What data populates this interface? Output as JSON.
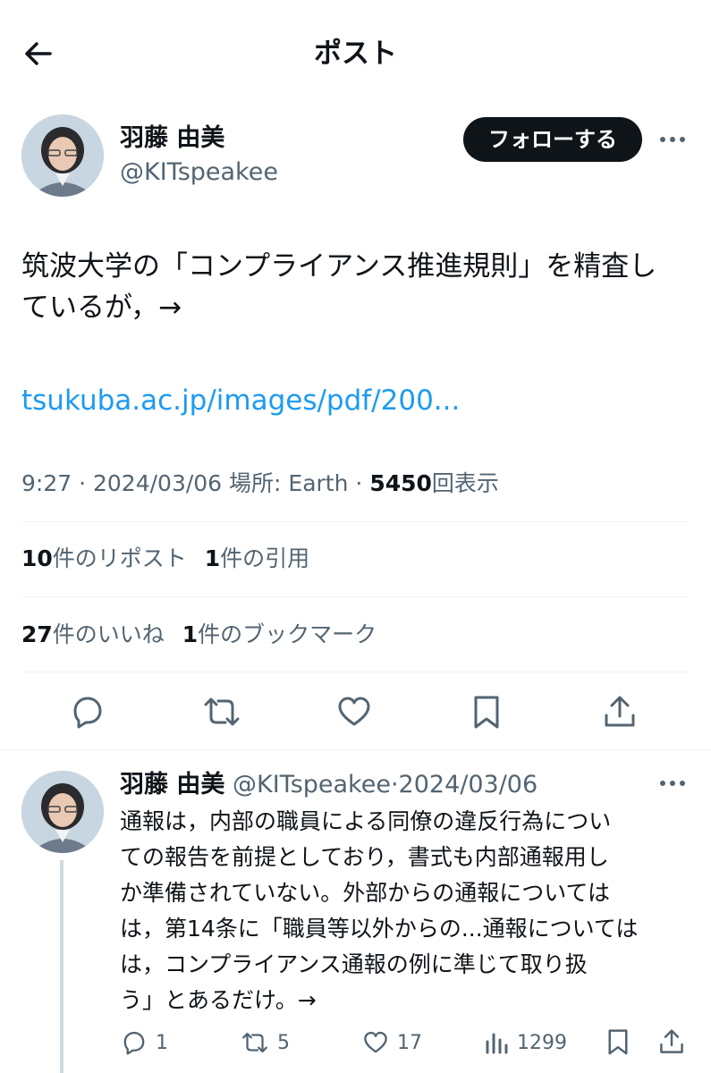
{
  "header": {
    "title": "ポスト",
    "back_icon": "arrow-left-icon"
  },
  "author": {
    "name": "羽藤 由美",
    "handle": "@KITspeakee",
    "follow_label": "フォローする",
    "more_icon": "more-horizontal-icon"
  },
  "post": {
    "text_line1": "筑波大学の「コンプライアンス推進規則」を精査し",
    "text_line2": "ているが，→",
    "link": "tsukuba.ac.jp/images/pdf/200..."
  },
  "meta": {
    "time": "9:27",
    "dot1": "·",
    "date": "2024/03/06",
    "place": "場所: Earth",
    "dot2": "·",
    "views": "5450",
    "views_label": "回表示"
  },
  "stats": {
    "reposts_count": "10",
    "reposts_label": "件のリポスト",
    "quotes_count": "1",
    "quotes_label": "件の引用",
    "likes_count": "27",
    "likes_label": "件のいいね",
    "bookmarks_count": "1",
    "bookmarks_label": "件のブックマーク"
  },
  "actions": {
    "reply_icon": "reply-icon",
    "repost_icon": "repost-icon",
    "like_icon": "heart-icon",
    "bookmark_icon": "bookmark-icon",
    "share_icon": "share-icon"
  },
  "reply": {
    "name": "羽藤 由美",
    "handle": "@KITspeakee",
    "sep": "·",
    "date": "2024/03/06",
    "lines": [
      "通報は，内部の職員による同僚の違反行為につい",
      "ての報告を前提としており，書式も内部通報用し",
      "か準備されていない。外部からの通報については",
      "は，第14条に「職員等以外からの...通報については",
      "は，コンプライアンス通報の例に準じて取り扱",
      "う」とあるだけ。→"
    ],
    "reply_count": "1",
    "repost_count": "5",
    "like_count": "17",
    "view_count": "1299"
  },
  "colors": {
    "link": "#1d9bf0",
    "muted": "#536471",
    "divider": "#eff3f4",
    "thread_line": "#cfd9de"
  }
}
